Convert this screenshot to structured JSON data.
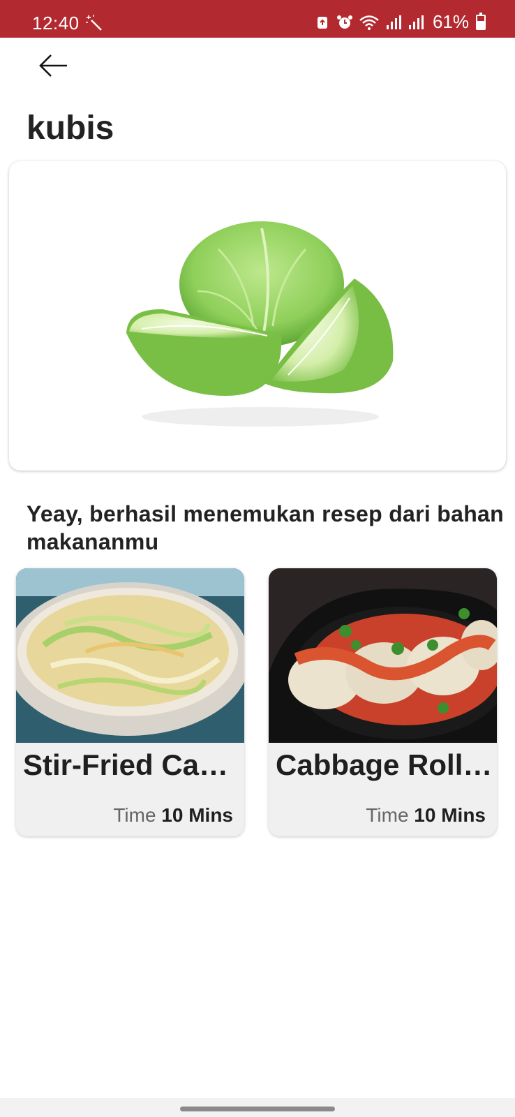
{
  "status_bar": {
    "time": "12:40",
    "battery": "61%",
    "battery_level": 0.61,
    "icons": [
      "magic-wand-icon",
      "recycle-icon",
      "alarm-icon",
      "wifi-icon",
      "signal-icon",
      "signal-icon",
      "battery-icon"
    ]
  },
  "app_bar": {
    "back_icon": "arrow-left-icon",
    "title": "kubis"
  },
  "ingredient": {
    "image": "cabbage-photo"
  },
  "result_message": {
    "line1": "Yeay, berhasil menemukan resep dari bahan",
    "line2": "makananmu"
  },
  "recipes": [
    {
      "title": "Stir-Fried Cab...",
      "time_label": "Time",
      "time_value": "10 Mins",
      "image": "stir-fried-cabbage-photo"
    },
    {
      "title": "Cabbage Rolls...",
      "time_label": "Time",
      "time_value": "10 Mins",
      "image": "cabbage-rolls-photo"
    }
  ],
  "colors": {
    "status_bar": "#b22a30",
    "card_background": "#f0f0f0",
    "cabbage_green": "#8fcf5a"
  }
}
